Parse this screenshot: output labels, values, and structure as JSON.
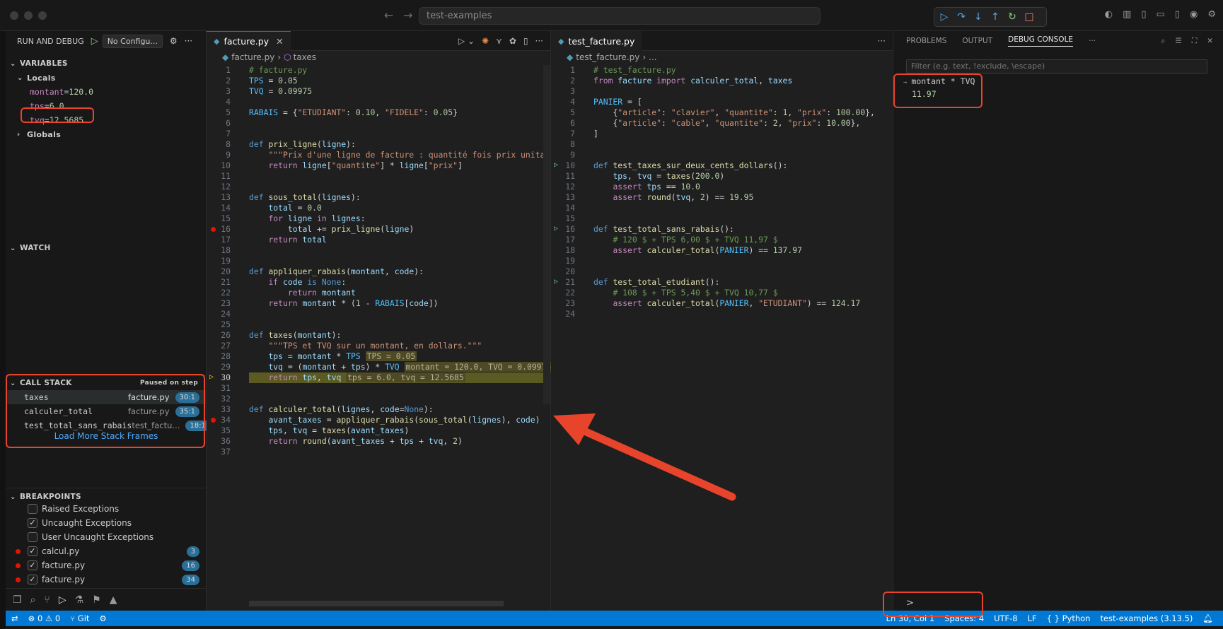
{
  "titlebar": {
    "search": "test-examples"
  },
  "sidebar": {
    "run_debug_label": "RUN AND DEBUG",
    "config_label": "No Configu...",
    "variables_title": "VARIABLES",
    "locals_title": "Locals",
    "locals": [
      {
        "name": "montant",
        "value": "120.0"
      },
      {
        "name": "tps",
        "value": "6.0"
      },
      {
        "name": "tvq",
        "value": "12.5685"
      }
    ],
    "globals_title": "Globals",
    "watch_title": "WATCH",
    "callstack_title": "CALL STACK",
    "callstack_status": "Paused on step",
    "frames": [
      {
        "fn": "taxes",
        "file": "facture.py",
        "pos": "30:1"
      },
      {
        "fn": "calculer_total",
        "file": "facture.py",
        "pos": "35:1"
      },
      {
        "fn": "test_total_sans_rabais",
        "file": "test_factu...",
        "pos": "18:1"
      }
    ],
    "load_more": "Load More Stack Frames",
    "breakpoints_title": "BREAKPOINTS",
    "breakpoints": [
      {
        "label": "Raised Exceptions",
        "checked": false,
        "dot": false,
        "count": ""
      },
      {
        "label": "Uncaught Exceptions",
        "checked": true,
        "dot": false,
        "count": ""
      },
      {
        "label": "User Uncaught Exceptions",
        "checked": false,
        "dot": false,
        "count": ""
      },
      {
        "label": "calcul.py",
        "checked": true,
        "dot": true,
        "count": "3"
      },
      {
        "label": "facture.py",
        "checked": true,
        "dot": true,
        "count": "16"
      },
      {
        "label": "facture.py",
        "checked": true,
        "dot": true,
        "count": "34"
      }
    ]
  },
  "editor1": {
    "tab": "facture.py",
    "breadcrumb_file": "facture.py",
    "breadcrumb_symbol": "taxes",
    "lines": [
      "# facture.py",
      "TPS = 0.05",
      "TVQ = 0.09975",
      "",
      "RABAIS = {\"ETUDIANT\": 0.10, \"FIDELE\": 0.05}",
      "",
      "",
      "def prix_ligne(ligne):",
      "    \"\"\"Prix d'une ligne de facture : quantité fois prix unitaire.",
      "    return ligne[\"quantite\"] * ligne[\"prix\"]",
      "",
      "",
      "def sous_total(lignes):",
      "    total = 0.0",
      "    for ligne in lignes:",
      "        total += prix_ligne(ligne)",
      "    return total",
      "",
      "",
      "def appliquer_rabais(montant, code):",
      "    if code is None:",
      "        return montant",
      "    return montant * (1 - RABAIS[code])",
      "",
      "",
      "def taxes(montant):",
      "    \"\"\"TPS et TVQ sur un montant, en dollars.\"\"\"",
      "    tps = montant * TPS",
      "    tvq = (montant + tps) * TVQ",
      "    return tps, tvq",
      "",
      "",
      "def calculer_total(lignes, code=None):",
      "    avant_taxes = appliquer_rabais(sous_total(lignes), code)",
      "    tps, tvq = taxes(avant_taxes)",
      "    return round(avant_taxes + tps + tvq, 2)",
      ""
    ],
    "inline": {
      "l28": "TPS = 0.05",
      "l29": "montant = 120.0, TVQ = 0.09975",
      "l30": "tps = 6.0, tvq = 12.5685"
    }
  },
  "editor2": {
    "tab": "test_facture.py",
    "breadcrumb_file": "test_facture.py",
    "breadcrumb_symbol": "...",
    "lines": [
      "# test_facture.py",
      "from facture import calculer_total, taxes",
      "",
      "PANIER = [",
      "    {\"article\": \"clavier\", \"quantite\": 1, \"prix\": 100.00},",
      "    {\"article\": \"cable\", \"quantite\": 2, \"prix\": 10.00},",
      "]",
      "",
      "",
      "def test_taxes_sur_deux_cents_dollars():",
      "    tps, tvq = taxes(200.0)",
      "    assert tps == 10.0",
      "    assert round(tvq, 2) == 19.95",
      "",
      "",
      "def test_total_sans_rabais():",
      "    # 120 $ + TPS 6,00 $ + TVQ 11,97 $",
      "    assert calculer_total(PANIER) == 137.97",
      "",
      "",
      "def test_total_etudiant():",
      "    # 108 $ + TPS 5,40 $ + TVQ 10,77 $",
      "    assert calculer_total(PANIER, \"ETUDIANT\") == 124.17",
      ""
    ]
  },
  "panel": {
    "tabs": [
      "PROBLEMS",
      "OUTPUT",
      "DEBUG CONSOLE"
    ],
    "filter_placeholder": "Filter (e.g. text, !exclude, \\escape)",
    "console_input": "montant * TVQ",
    "console_output": "11.97",
    "prompt": ">"
  },
  "statusbar": {
    "errors": "0",
    "warnings": "0",
    "git": "Git",
    "position": "Ln 30, Col 1",
    "spaces": "Spaces: 4",
    "encoding": "UTF-8",
    "eol": "LF",
    "lang": "Python",
    "interpreter": "test-examples (3.13.5)"
  },
  "colors": {
    "accent": "#0078d4",
    "annotation": "#e8442c",
    "current_line": "#5b5a22"
  }
}
